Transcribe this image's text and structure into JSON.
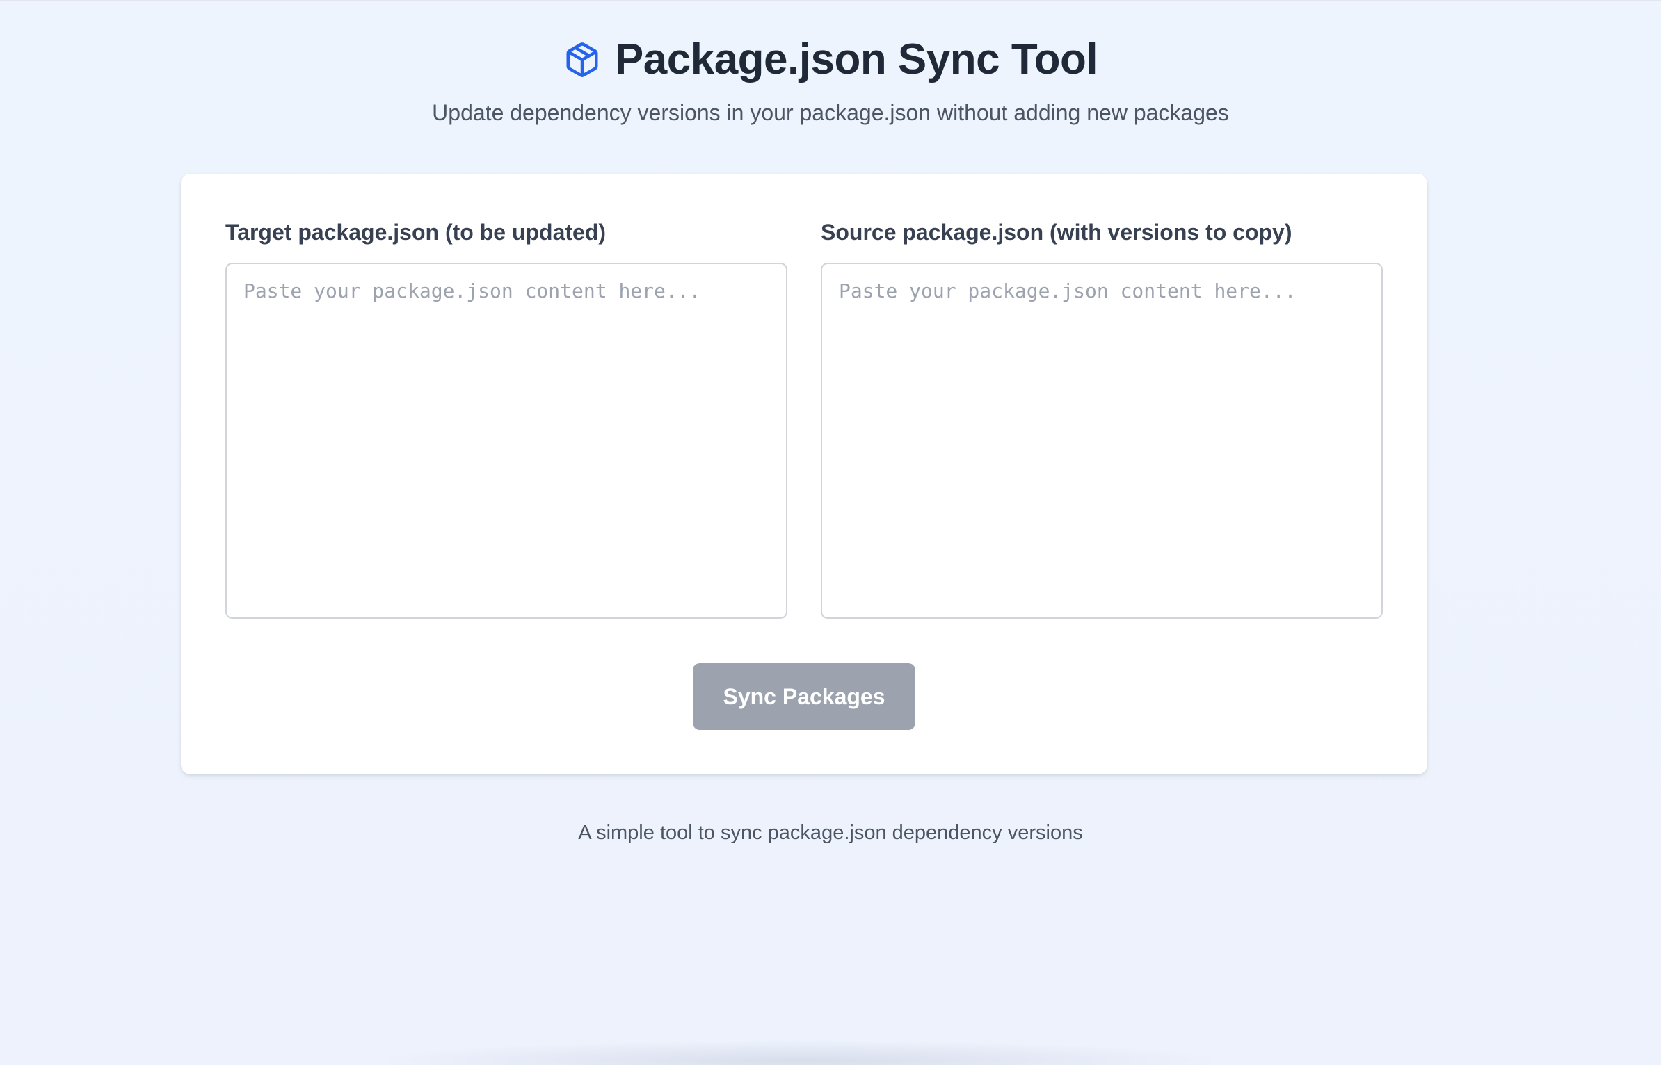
{
  "header": {
    "icon": "package-icon",
    "title": "Package.json Sync Tool",
    "subtitle": "Update dependency versions in your package.json without adding new packages"
  },
  "form": {
    "target": {
      "label": "Target package.json (to be updated)",
      "placeholder": "Paste your package.json content here...",
      "value": ""
    },
    "source": {
      "label": "Source package.json (with versions to copy)",
      "placeholder": "Paste your package.json content here...",
      "value": ""
    },
    "sync_button_label": "Sync Packages"
  },
  "footer": {
    "text": "A simple tool to sync package.json dependency versions"
  },
  "colors": {
    "accent": "#2563eb",
    "button_disabled": "#9ca3af",
    "background": "#eef4fd"
  }
}
